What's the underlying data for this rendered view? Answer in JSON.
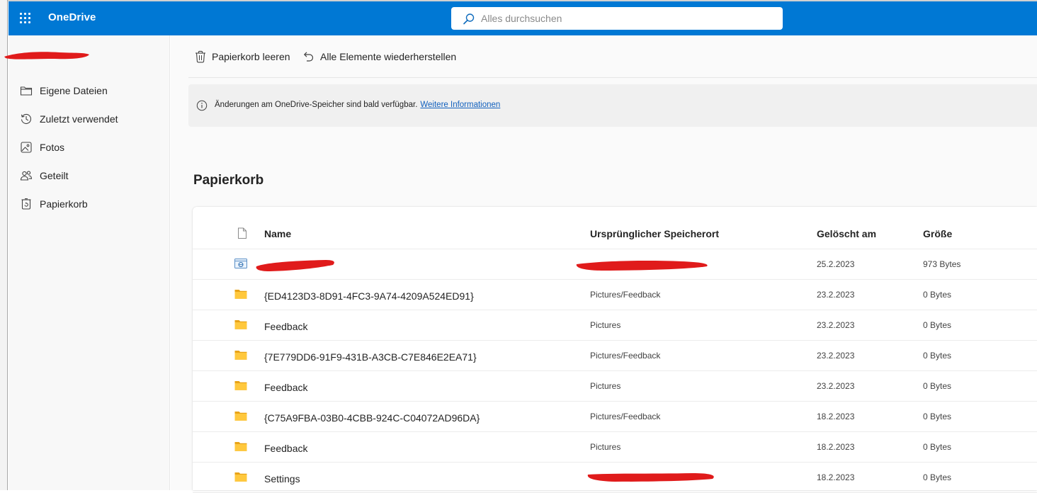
{
  "app": {
    "name": "OneDrive"
  },
  "search": {
    "placeholder": "Alles durchsuchen"
  },
  "sidebar": {
    "items": [
      {
        "label": "Eigene Dateien",
        "icon": "folder-icon"
      },
      {
        "label": "Zuletzt verwendet",
        "icon": "history-icon"
      },
      {
        "label": "Fotos",
        "icon": "photo-icon"
      },
      {
        "label": "Geteilt",
        "icon": "people-icon"
      },
      {
        "label": "Papierkorb",
        "icon": "recycle-bin-icon"
      }
    ]
  },
  "toolbar": {
    "empty_bin_label": "Papierkorb leeren",
    "restore_all_label": "Alle Elemente wiederherstellen"
  },
  "notice": {
    "text": "Änderungen am OneDrive-Speicher sind bald verfügbar.",
    "link": "Weitere Informationen"
  },
  "page": {
    "title": "Papierkorb"
  },
  "table": {
    "columns": {
      "name": "Name",
      "location": "Ursprünglicher Speicherort",
      "deleted": "Gelöscht am",
      "size": "Größe"
    },
    "rows": [
      {
        "type": "file",
        "name": "",
        "location": "",
        "deleted": "25.2.2023",
        "size": "973 Bytes"
      },
      {
        "type": "folder",
        "name": "{ED4123D3-8D91-4FC3-9A74-4209A524ED91}",
        "location": "Pictures/Feedback",
        "deleted": "23.2.2023",
        "size": "0 Bytes"
      },
      {
        "type": "folder",
        "name": "Feedback",
        "location": "Pictures",
        "deleted": "23.2.2023",
        "size": "0 Bytes"
      },
      {
        "type": "folder",
        "name": "{7E779DD6-91F9-431B-A3CB-C7E846E2EA71}",
        "location": "Pictures/Feedback",
        "deleted": "23.2.2023",
        "size": "0 Bytes"
      },
      {
        "type": "folder",
        "name": "Feedback",
        "location": "Pictures",
        "deleted": "23.2.2023",
        "size": "0 Bytes"
      },
      {
        "type": "folder",
        "name": "{C75A9FBA-03B0-4CBB-924C-C04072AD96DA}",
        "location": "Pictures/Feedback",
        "deleted": "18.2.2023",
        "size": "0 Bytes"
      },
      {
        "type": "folder",
        "name": "Feedback",
        "location": "Pictures",
        "deleted": "18.2.2023",
        "size": "0 Bytes"
      },
      {
        "type": "folder",
        "name": "Settings",
        "location": "",
        "deleted": "18.2.2023",
        "size": "0 Bytes"
      }
    ]
  },
  "colors": {
    "brand_blue": "#0078d4",
    "folder_yellow": "#ffc83d",
    "redaction_red": "#e01b1b"
  }
}
